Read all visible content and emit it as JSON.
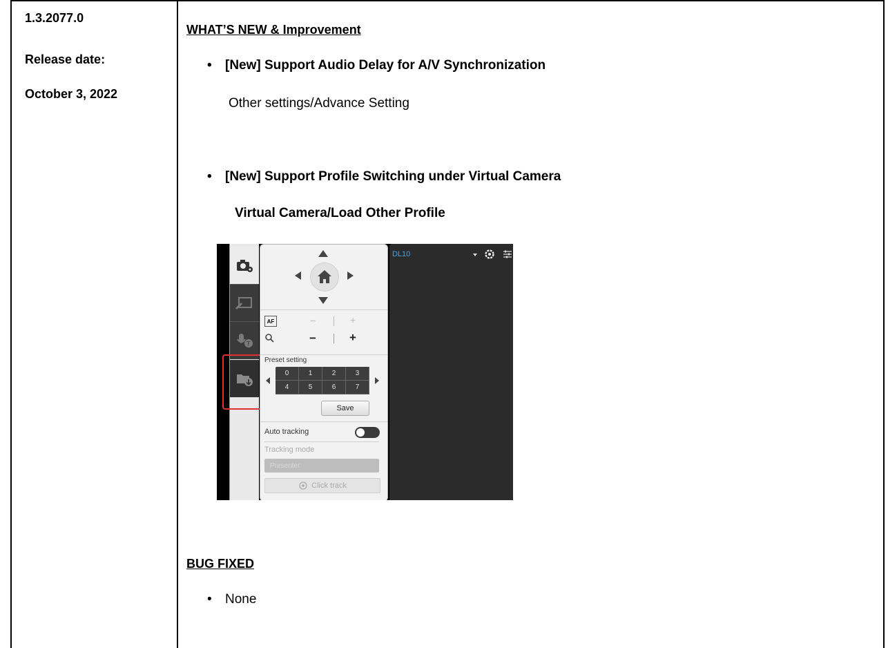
{
  "left": {
    "version": "1.3.2077.0",
    "release_label": "Release date:",
    "release_date": "October 3, 2022"
  },
  "whats_new": {
    "heading": "WHAT’S NEW & Improvement",
    "items": [
      {
        "title": "[New] Support Audio Delay for A/V Synchronization",
        "detail": "Other settings/Advance Setting"
      },
      {
        "title": "[New] Support Profile Switching under Virtual Camera",
        "detail": "Virtual Camera/Load Other Profile"
      }
    ]
  },
  "screenshot": {
    "preset_label": "Preset setting",
    "presets": [
      "0",
      "1",
      "2",
      "3",
      "4",
      "5",
      "6",
      "7"
    ],
    "save_label": "Save",
    "auto_tracking_label": "Auto tracking",
    "tracking_mode_label": "Tracking mode",
    "tracking_mode_value": "Presenter",
    "click_track_label": "Click track",
    "af_label": "AF",
    "camera_name": "DL10"
  },
  "bug_fixed": {
    "heading": "BUG FIXED",
    "items": [
      "None"
    ]
  }
}
